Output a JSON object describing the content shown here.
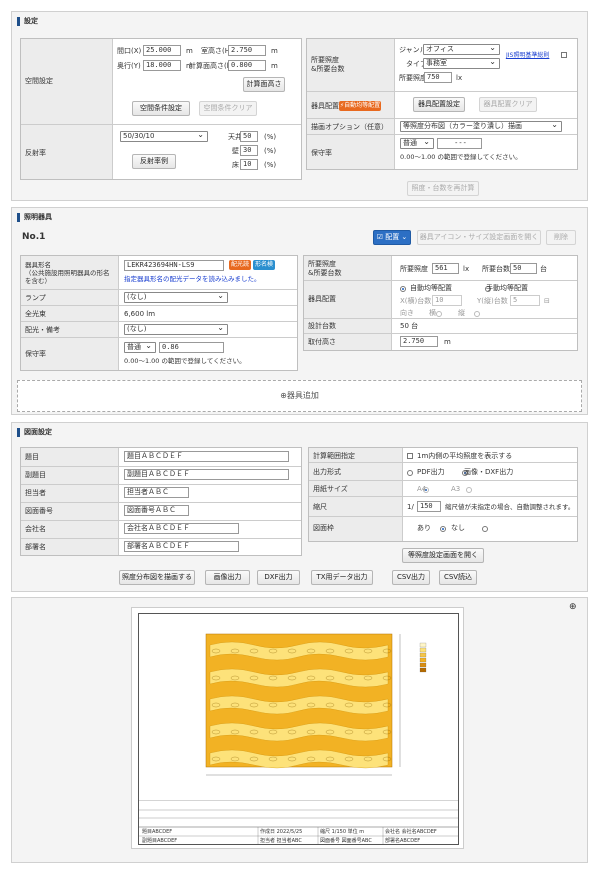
{
  "settings": {
    "title": "設定",
    "room": {
      "label": "空間設定",
      "width_label": "間口(X)",
      "width": "25.000",
      "unit_m": "m",
      "depth_label": "奥行(Y)",
      "depth": "18.000",
      "ceiling_label": "室高さ(H)",
      "ceiling": "2.750",
      "calc_h_label": "計算面高さ(h)",
      "calc_h": "0.800",
      "calc_btn": "計算面高さ",
      "cond_btn": "空間条件設定",
      "clear_btn": "空間条件クリア"
    },
    "reflect": {
      "label": "反射率",
      "select": "50/30/10",
      "ceiling_label": "天井",
      "ceiling": "50",
      "wall_label": "壁",
      "wall": "30",
      "floor_label": "床",
      "floor": "10",
      "pct": "(%)",
      "example_btn": "反射率例"
    },
    "target": {
      "label": "所要照度\n&所要台数",
      "genre_label": "ジャンル",
      "genre": "オフィス",
      "jis_link": "JIS照明基準総則",
      "type_label": "タイプ",
      "type": "事務室",
      "lux_label": "所要照度",
      "lux": "750",
      "lux_unit": "lx"
    },
    "layout": {
      "label": "器具配置",
      "badge": "自動均等配置",
      "set_btn": "器具配置設定",
      "clear_btn": "器具配置クリア"
    },
    "option": {
      "label": "描画オプション（任意）",
      "select": "等照度分布図（カラー塗り潰し）描画"
    },
    "maint": {
      "label": "保守率",
      "select": "普通",
      "value": "---",
      "note": "0.00〜1.00 の範囲で登録してください。"
    },
    "recalc_btn": "照度・台数を再計算"
  },
  "fixture": {
    "title": "照明器具",
    "no": "No.1",
    "place_btn": "配置",
    "icon_btn": "器具アイコン・サイズ設定画面を開く",
    "delete_btn": "削除",
    "model_label": "器具形名\n（公共施設用照明器具の形名\nを含む）",
    "model": "LEKR423694HN-LS9",
    "tag1": "配光読込",
    "tag2": "形名検索",
    "note": "指定器具形名の配光データを読み込みました。",
    "lamp_label": "ランプ",
    "lamp": "(なし)",
    "lumen_label": "全光束",
    "lumen": "6,600 lm",
    "dist_label": "配光・備考",
    "dist": "(なし)",
    "maint_label": "保守率",
    "maint_select": "普通",
    "maint_value": "0.86",
    "maint_note": "0.00〜1.00 の範囲で登録してください。",
    "req_label": "所要照度\n&所要台数",
    "req_lux_label": "所要照度",
    "req_lux": "561",
    "lx": "lx",
    "req_count_label": "所要台数",
    "req_count": "50",
    "dai": "台",
    "arr_label": "器具配置",
    "auto": "自動均等配置",
    "manual": "手動均等配置",
    "x_label": "X(横)台数",
    "x_val": "10",
    "y_label": "Y(縦)台数",
    "y_val": "5",
    "dir_label": "向き",
    "yoko": "横",
    "tate": "縦",
    "count_label": "設計台数",
    "count": "50 台",
    "height_label": "取付高さ",
    "height": "2.750",
    "m": "m"
  },
  "add_fixture": "器具追加",
  "drawing": {
    "title": "図面設定",
    "fields": [
      {
        "label": "題目",
        "value": "題目ＡＢＣＤＥＦ"
      },
      {
        "label": "副題目",
        "value": "副題目ＡＢＣＤＥＦ"
      },
      {
        "label": "担当者",
        "value": "担当者ＡＢＣ"
      },
      {
        "label": "図面番号",
        "value": "図面番号ＡＢＣ"
      },
      {
        "label": "会社名",
        "value": "会社名ＡＢＣＤＥＦ"
      },
      {
        "label": "部署名",
        "value": "部署名ＡＢＣＤＥＦ"
      }
    ],
    "range_label": "計算範囲指定",
    "range_chk": "1m内側の平均照度を表示する",
    "out_label": "出力形式",
    "pdf": "PDF出力",
    "img": "画像・DXF出力",
    "paper_label": "用紙サイズ",
    "a4": "A4",
    "a3": "A3",
    "scale_label": "縮尺",
    "scale_pre": "1/",
    "scale": "150",
    "scale_note": "縮尺値が未指定の場合、自動調整されます。",
    "frame_label": "図面枠",
    "ari": "あり",
    "nashi": "なし",
    "open_btn": "等照度設定画面を開く",
    "actions": [
      "照度分布図を描画する",
      "画像出力",
      "DXF出力",
      "TX用データ出力",
      "CSV出力",
      "CSV読込"
    ]
  },
  "preview": {
    "zoom_icon": "zoom-in",
    "footer": {
      "title": "題目ABCDEF",
      "subtitle": "副題目ABCDEF",
      "date_label": "作成日",
      "date": "2022/5/25",
      "scale_label": "縮尺",
      "scale": "1/150 単位 m",
      "company_label": "会社名",
      "company": "会社名ABCDEF",
      "person_label": "担当者",
      "person": "担当者ABC",
      "dept": "部署名ABCDEF",
      "num_label": "図面番号",
      "num": "図面番号ABC"
    }
  }
}
